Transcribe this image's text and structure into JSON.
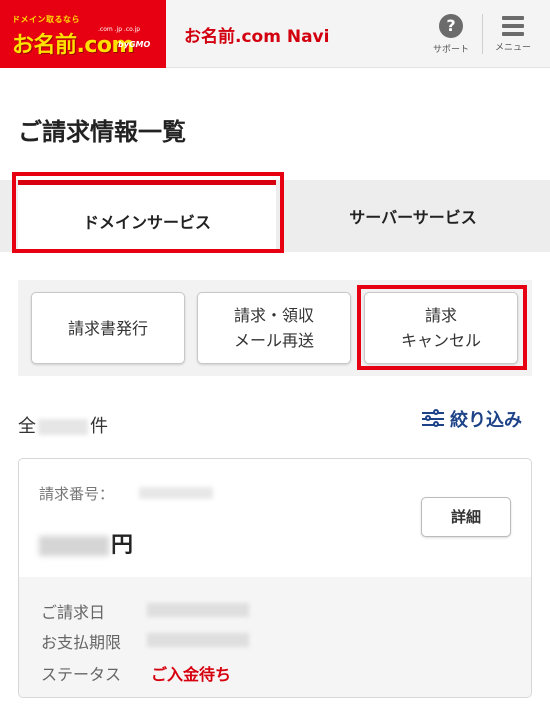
{
  "header": {
    "logo_tagline": "ドメイン取るなら",
    "logo_tld": ".com .jp .co.jp",
    "logo_text": "お名前.com",
    "logo_gmo": "byGMO",
    "navi_title": "お名前.com Navi",
    "support_icon": "question-circle-icon",
    "support_label": "サポート",
    "menu_icon": "hamburger-menu-icon",
    "menu_label": "メニュー",
    "brand_color": "#e60012"
  },
  "page": {
    "title": "ご請求情報一覧"
  },
  "tabs": [
    {
      "label": "ドメインサービス",
      "active": true
    },
    {
      "label": "サーバーサービス",
      "active": false
    }
  ],
  "actions": [
    {
      "label": "請求書発行"
    },
    {
      "label": "請求・領収\nメール再送"
    },
    {
      "label": "請求\nキャンセル"
    }
  ],
  "list": {
    "count_prefix": "全",
    "count_suffix": "件",
    "filter_label": "絞り込み",
    "filter_icon": "sliders-icon"
  },
  "invoice": {
    "number_label": "請求番号：",
    "amount_unit": "円",
    "detail_label": "詳細",
    "billing_date_label": "ご請求日",
    "due_date_label": "お支払期限",
    "status_label": "ステータス",
    "status_value": "ご入金待ち",
    "status_color": "#d7000f"
  }
}
